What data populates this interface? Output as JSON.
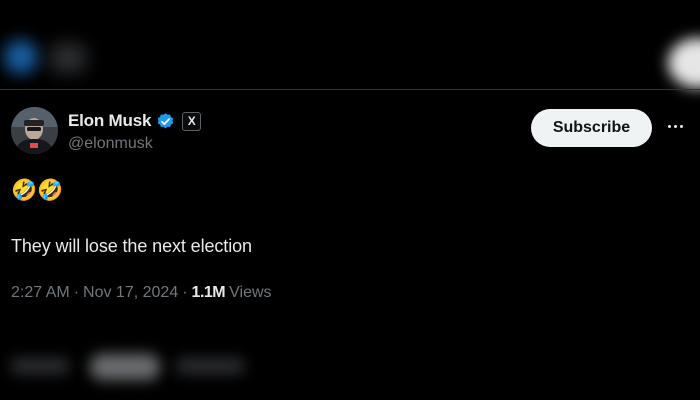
{
  "tweet": {
    "author": {
      "display_name": "Elon Musk",
      "handle": "@elonmusk",
      "verified_icon": "verified-badge-icon",
      "affiliation_badge": "X"
    },
    "subscribe_label": "Subscribe",
    "more_icon": "more-options-icon",
    "emojis": [
      "🤣",
      "🤣"
    ],
    "text": "They will lose the next election",
    "time": "2:27 AM",
    "separator": "·",
    "date": "Nov 17, 2024",
    "views_count": "1.1M",
    "views_label": "Views"
  },
  "colors": {
    "background": "#000000",
    "primary_text": "#e7e9ea",
    "secondary_text": "#71767b",
    "verified_blue": "#1d9bf0",
    "button_bg": "#eff3f4",
    "button_text": "#0f1419"
  }
}
